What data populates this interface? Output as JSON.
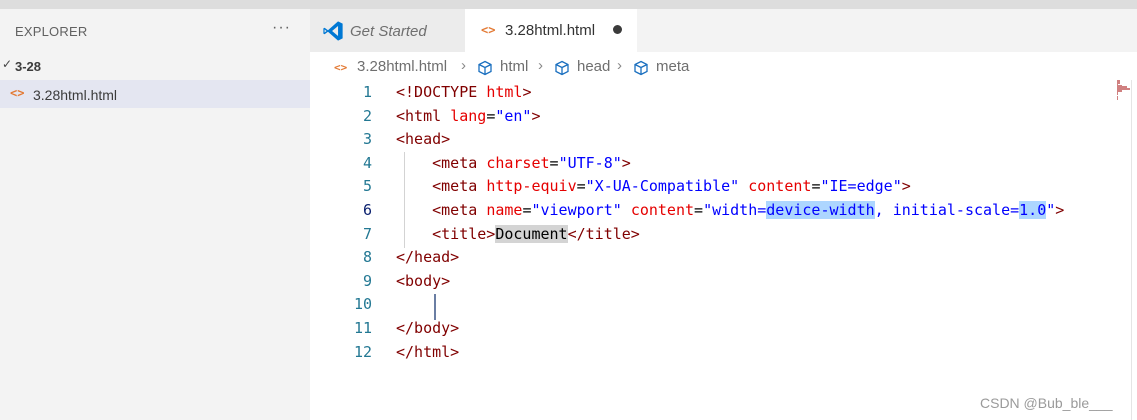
{
  "sidebar": {
    "title": "EXPLORER",
    "more_label": "···",
    "folder": {
      "chevron": "✓",
      "name": "3-28"
    },
    "files": [
      {
        "icon": "<>",
        "name": "3.28html.html"
      }
    ]
  },
  "tabs": [
    {
      "label": "Get Started",
      "icon": "vscode-logo-icon",
      "active": false
    },
    {
      "label": "3.28html.html",
      "icon": "<>",
      "active": true,
      "dirty": true
    }
  ],
  "breadcrumb": {
    "items": [
      {
        "label": "3.28html.html",
        "icon": "<>"
      },
      {
        "label": "html",
        "icon": "cube-icon"
      },
      {
        "label": "head",
        "icon": "cube-icon"
      },
      {
        "label": "meta",
        "icon": "cube-icon"
      }
    ],
    "separator": "›"
  },
  "editor": {
    "line_numbers": [
      "1",
      "2",
      "3",
      "4",
      "5",
      "6",
      "7",
      "8",
      "9",
      "10",
      "11",
      "12"
    ],
    "active_line": "6",
    "lines": [
      {
        "tokens": [
          {
            "c": "punc",
            "t": "<!DOCTYPE "
          },
          {
            "c": "attr",
            "t": "html"
          },
          {
            "c": "punc",
            "t": ">"
          }
        ]
      },
      {
        "tokens": [
          {
            "c": "punc",
            "t": "<html "
          },
          {
            "c": "attr",
            "t": "lang"
          },
          {
            "c": "txt",
            "t": "="
          },
          {
            "c": "str",
            "t": "\"en\""
          },
          {
            "c": "punc",
            "t": ">"
          }
        ]
      },
      {
        "tokens": [
          {
            "c": "punc",
            "t": "<head>"
          }
        ]
      },
      {
        "tokens": [
          {
            "c": "txt",
            "t": "    "
          },
          {
            "c": "punc",
            "t": "<meta "
          },
          {
            "c": "attr",
            "t": "charset"
          },
          {
            "c": "txt",
            "t": "="
          },
          {
            "c": "str",
            "t": "\"UTF-8\""
          },
          {
            "c": "punc",
            "t": ">"
          }
        ]
      },
      {
        "tokens": [
          {
            "c": "txt",
            "t": "    "
          },
          {
            "c": "punc",
            "t": "<meta "
          },
          {
            "c": "attr",
            "t": "http-equiv"
          },
          {
            "c": "txt",
            "t": "="
          },
          {
            "c": "str",
            "t": "\"X-UA-Compatible\""
          },
          {
            "c": "txt",
            "t": " "
          },
          {
            "c": "attr",
            "t": "content"
          },
          {
            "c": "txt",
            "t": "="
          },
          {
            "c": "str",
            "t": "\"IE=edge\""
          },
          {
            "c": "punc",
            "t": ">"
          }
        ]
      },
      {
        "tokens": [
          {
            "c": "txt",
            "t": "    "
          },
          {
            "c": "punc",
            "t": "<meta "
          },
          {
            "c": "attr",
            "t": "name"
          },
          {
            "c": "txt",
            "t": "="
          },
          {
            "c": "str",
            "t": "\"viewport\""
          },
          {
            "c": "txt",
            "t": " "
          },
          {
            "c": "attr",
            "t": "content"
          },
          {
            "c": "txt",
            "t": "="
          },
          {
            "c": "str",
            "t": "\"width="
          },
          {
            "c": "str sel",
            "t": "device-width"
          },
          {
            "c": "str",
            "t": ", initial-scale="
          },
          {
            "c": "str sel",
            "t": "1.0"
          },
          {
            "c": "str",
            "t": "\""
          },
          {
            "c": "punc",
            "t": ">"
          }
        ]
      },
      {
        "tokens": [
          {
            "c": "txt",
            "t": "    "
          },
          {
            "c": "punc",
            "t": "<title>"
          },
          {
            "c": "txt hl",
            "t": "Document"
          },
          {
            "c": "punc",
            "t": "</title>"
          }
        ]
      },
      {
        "tokens": [
          {
            "c": "punc",
            "t": "</head>"
          }
        ]
      },
      {
        "tokens": [
          {
            "c": "punc",
            "t": "<body>"
          }
        ]
      },
      {
        "tokens": [
          {
            "c": "txt",
            "t": ""
          }
        ]
      },
      {
        "tokens": [
          {
            "c": "punc",
            "t": "</body>"
          }
        ]
      },
      {
        "tokens": [
          {
            "c": "punc",
            "t": "</html>"
          }
        ]
      }
    ]
  },
  "watermark": "CSDN @Bub_ble___",
  "colors": {
    "tag": "#800000",
    "attribute": "#e50000",
    "string": "#0000ff",
    "line_number": "#237893",
    "selection": "#add6ff",
    "file_icon": "#e37933",
    "vscode_blue": "#0078d4"
  }
}
